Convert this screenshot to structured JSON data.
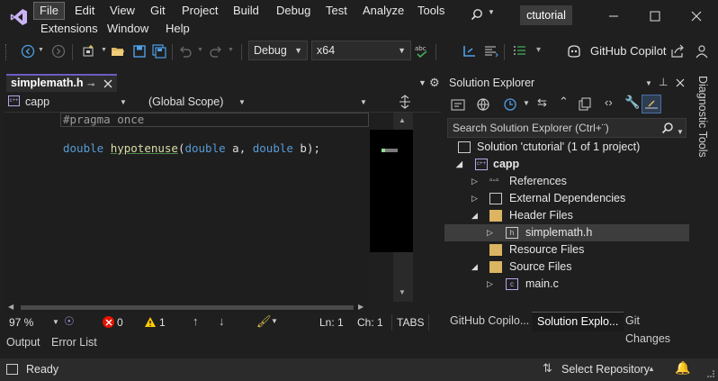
{
  "menu": [
    "File",
    "Edit",
    "View",
    "Git",
    "Project",
    "Build",
    "Debug",
    "Test",
    "Analyze",
    "Tools",
    "Extensions",
    "Window",
    "Help"
  ],
  "solution_name": "ctutorial",
  "toolbar": {
    "config": "Debug",
    "platform": "x64",
    "copilot": "GitHub Copilot"
  },
  "editor": {
    "tab_label": "simplemath.h",
    "project_dropdown": "capp",
    "scope_dropdown": "(Global Scope)",
    "code": {
      "line1": "#pragma once",
      "kw_double1": "double",
      "fn_name": "hypotenuse",
      "paren_open": "(",
      "kw_double2": "double",
      "param_a": " a, ",
      "kw_double3": "double",
      "param_b_end": " b);"
    },
    "status": {
      "zoom": "97 %",
      "errors": "0",
      "warnings": "1",
      "line": "Ln: 1",
      "col": "Ch: 1",
      "tabs": "TABS"
    }
  },
  "bottom_tabs": [
    "Output",
    "Error List"
  ],
  "solution_explorer": {
    "title": "Solution Explorer",
    "search_placeholder": "Search Solution Explorer (Ctrl+¨)",
    "tree": [
      {
        "label": "Solution 'ctutorial' (1 of 1 project)"
      },
      {
        "label": "capp"
      },
      {
        "label": "References"
      },
      {
        "label": "External Dependencies"
      },
      {
        "label": "Header Files"
      },
      {
        "label": "simplemath.h"
      },
      {
        "label": "Resource Files"
      },
      {
        "label": "Source Files"
      },
      {
        "label": "main.c"
      }
    ],
    "bottom_tabs": [
      "GitHub Copilo...",
      "Solution Explo...",
      "Git Changes"
    ]
  },
  "side_panel": "Diagnostic Tools",
  "statusbar": {
    "ready": "Ready",
    "repo": "Select Repository"
  },
  "colors": {
    "accent": "#6c5cc2",
    "keyword": "#569cd6",
    "function": "#dcdcaa",
    "error": "#e51400",
    "warning": "#ffcc00"
  }
}
